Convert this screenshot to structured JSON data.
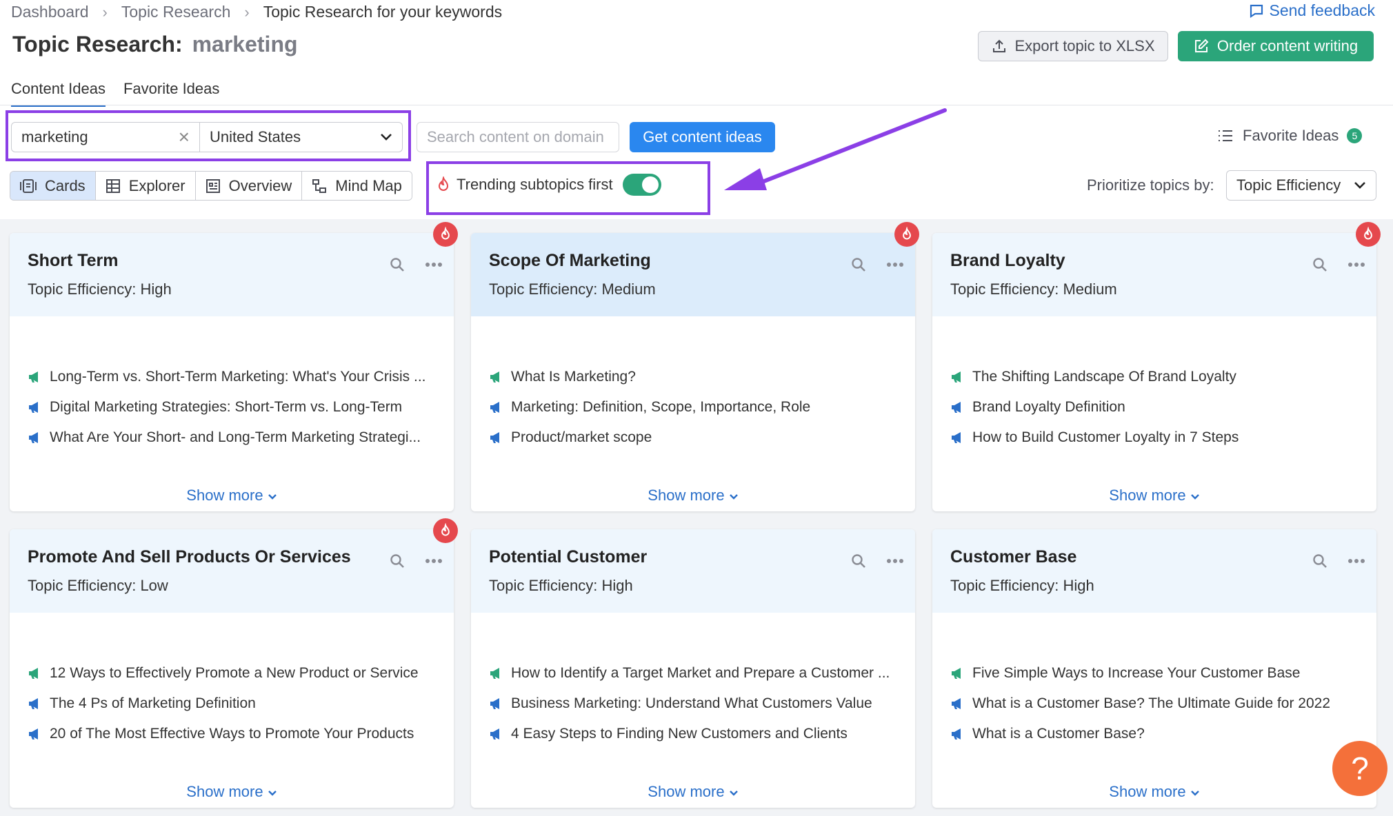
{
  "breadcrumb": [
    "Dashboard",
    "Topic Research",
    "Topic Research for your keywords"
  ],
  "send_feedback": "Send feedback",
  "title": {
    "label": "Topic Research:",
    "keyword": "marketing"
  },
  "export_label": "Export topic to XLSX",
  "order_label": "Order content writing",
  "tabs": [
    {
      "label": "Content Ideas",
      "active": true
    },
    {
      "label": "Favorite Ideas",
      "active": false
    }
  ],
  "search": {
    "keyword_value": "marketing",
    "country": "United States",
    "domain_placeholder": "Search content on domain",
    "get_label": "Get content ideas"
  },
  "favorite": {
    "label": "Favorite Ideas",
    "count": "5"
  },
  "views": [
    {
      "label": "Cards",
      "active": true
    },
    {
      "label": "Explorer",
      "active": false
    },
    {
      "label": "Overview",
      "active": false
    },
    {
      "label": "Mind Map",
      "active": false
    }
  ],
  "trending": {
    "label": "Trending subtopics first",
    "enabled": true
  },
  "prioritize": {
    "label": "Prioritize topics by:",
    "value": "Topic Efficiency"
  },
  "show_more": "Show more",
  "cards": [
    {
      "title": "Short Term",
      "efficiency": "Topic Efficiency: High",
      "trending": true,
      "items": [
        "Long-Term vs. Short-Term Marketing: What's Your Crisis ...",
        "Digital Marketing Strategies: Short-Term vs. Long-Term",
        "What Are Your Short- and Long-Term Marketing Strategi..."
      ]
    },
    {
      "title": "Scope Of Marketing",
      "efficiency": "Topic Efficiency: Medium",
      "trending": true,
      "items": [
        "What Is Marketing?",
        "Marketing: Definition, Scope, Importance, Role",
        "Product/market scope"
      ]
    },
    {
      "title": "Brand Loyalty",
      "efficiency": "Topic Efficiency: Medium",
      "trending": true,
      "items": [
        "The Shifting Landscape Of Brand Loyalty",
        "Brand Loyalty Definition",
        "How to Build Customer Loyalty in 7 Steps"
      ]
    },
    {
      "title": "Promote And Sell Products Or Services",
      "efficiency": "Topic Efficiency: Low",
      "trending": true,
      "items": [
        "12 Ways to Effectively Promote a New Product or Service",
        "The 4 Ps of Marketing Definition",
        "20 of The Most Effective Ways to Promote Your Products"
      ]
    },
    {
      "title": "Potential Customer",
      "efficiency": "Topic Efficiency: High",
      "trending": false,
      "items": [
        "How to Identify a Target Market and Prepare a Customer ...",
        "Business Marketing: Understand What Customers Value",
        "4 Easy Steps to Finding New Customers and Clients"
      ]
    },
    {
      "title": "Customer Base",
      "efficiency": "Topic Efficiency: High",
      "trending": false,
      "items": [
        "Five Simple Ways to Increase Your Customer Base",
        "What is a Customer Base? The Ultimate Guide for 2022",
        "What is a Customer Base?"
      ]
    }
  ],
  "help_label": "?",
  "colors": {
    "accent": "#2a6fc9",
    "green": "#2ba57a",
    "highlight": "#8b3fe6",
    "fire": "#e5484d"
  }
}
